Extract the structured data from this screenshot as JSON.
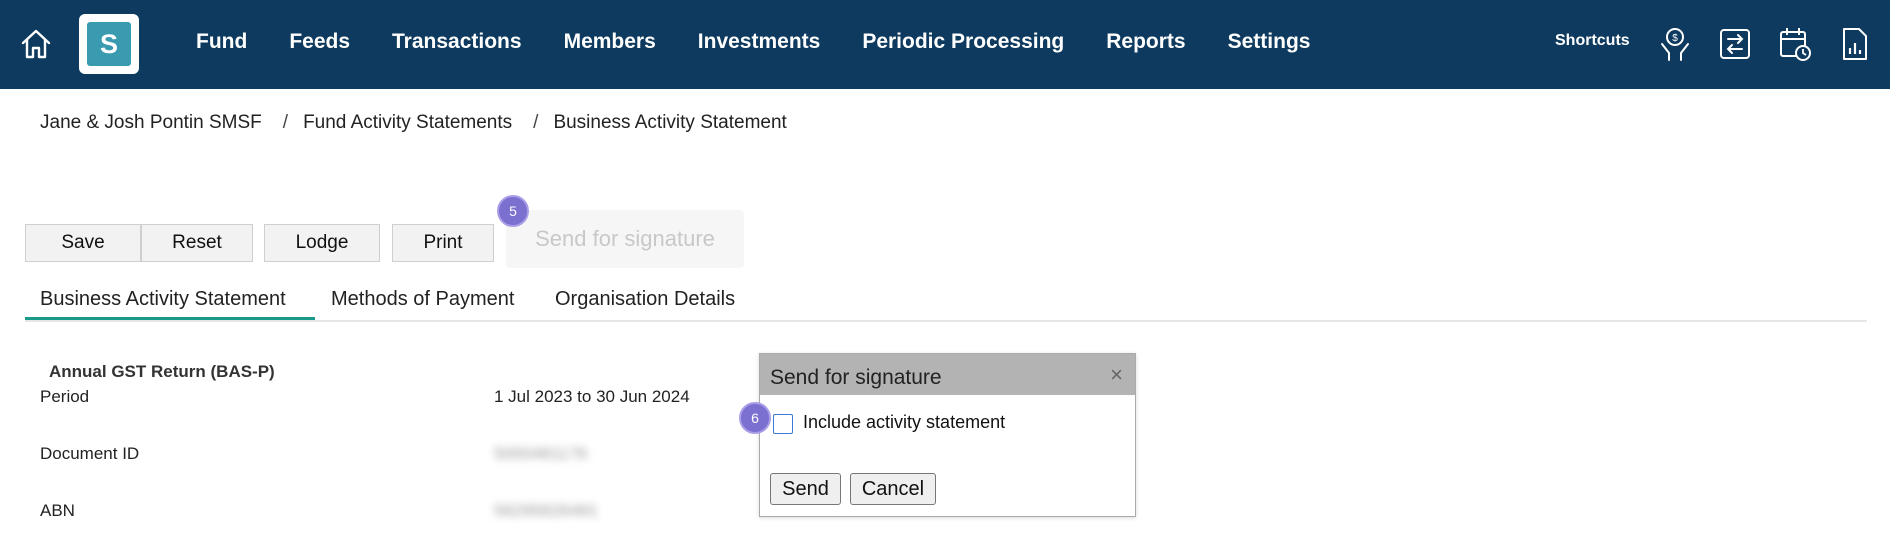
{
  "header": {
    "logo_letter": "S",
    "nav": [
      "Fund",
      "Feeds",
      "Transactions",
      "Members",
      "Investments",
      "Periodic Processing",
      "Reports",
      "Settings"
    ],
    "shortcuts_label": "Shortcuts"
  },
  "breadcrumb": {
    "items": [
      "Jane & Josh Pontin SMSF",
      "Fund Activity Statements",
      "Business Activity Statement"
    ],
    "separator": "/"
  },
  "toolbar": {
    "save": "Save",
    "reset": "Reset",
    "lodge": "Lodge",
    "print": "Print",
    "send_for_signature": "Send for signature",
    "step_badge_1": "5"
  },
  "tabs": [
    "Business Activity Statement",
    "Methods of Payment",
    "Organisation Details"
  ],
  "form": {
    "section_title": "Annual GST Return (BAS-P)",
    "period_label": "Period",
    "period_value": "1 Jul 2023 to 30 Jun 2024",
    "document_id_label": "Document ID",
    "document_id_value": "5000481176",
    "abn_label": "ABN",
    "abn_value": "56295826481"
  },
  "dialog": {
    "title": "Send for signature",
    "close": "×",
    "checkbox_label": "Include activity statement",
    "step_badge_2": "6",
    "send": "Send",
    "cancel": "Cancel"
  },
  "colors": {
    "topbar": "#0d3a5e",
    "logo": "#3a9bb0",
    "active_tab": "#1a9b8a",
    "step_badge": "#7b6fd0"
  }
}
